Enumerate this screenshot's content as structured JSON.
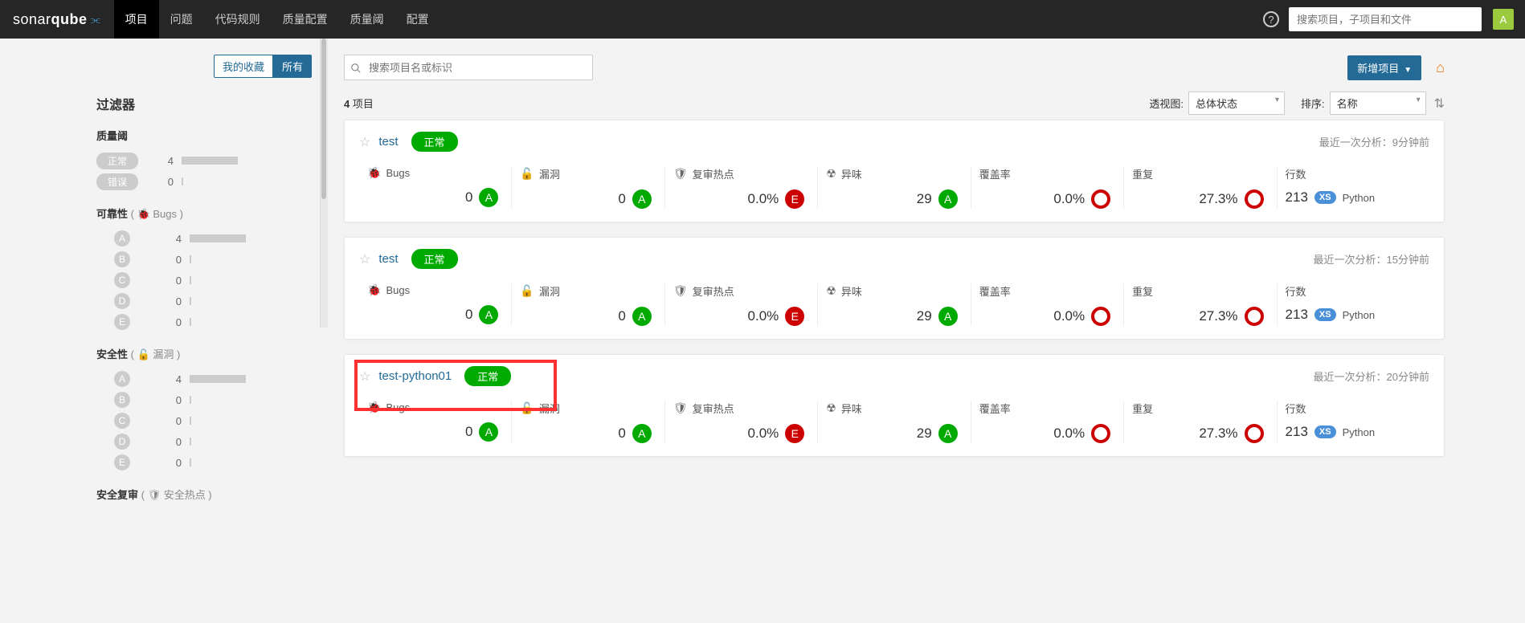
{
  "nav": {
    "brand_a": "sonar",
    "brand_b": "qube",
    "tabs": [
      "项目",
      "问题",
      "代码规则",
      "质量配置",
      "质量阈",
      "配置"
    ],
    "search_placeholder": "搜索项目，子项目和文件",
    "avatar": "A"
  },
  "sidebar": {
    "fav": "我的收藏",
    "all": "所有",
    "filter_title": "过滤器",
    "sections": {
      "quality_gate": {
        "title": "质量阈",
        "items": [
          {
            "label": "正常",
            "count": "4",
            "bar": 70
          },
          {
            "label": "错误",
            "count": "0",
            "bar": 0
          }
        ]
      },
      "reliability": {
        "title": "可靠性",
        "sub": "( 🐞 Bugs )",
        "items": [
          {
            "letter": "A",
            "count": "4",
            "bar": 70
          },
          {
            "letter": "B",
            "count": "0",
            "bar": 0
          },
          {
            "letter": "C",
            "count": "0",
            "bar": 0
          },
          {
            "letter": "D",
            "count": "0",
            "bar": 0
          },
          {
            "letter": "E",
            "count": "0",
            "bar": 0
          }
        ]
      },
      "security": {
        "title": "安全性",
        "sub": "( 🔓 漏洞 )",
        "items": [
          {
            "letter": "A",
            "count": "4",
            "bar": 70
          },
          {
            "letter": "B",
            "count": "0",
            "bar": 0
          },
          {
            "letter": "C",
            "count": "0",
            "bar": 0
          },
          {
            "letter": "D",
            "count": "0",
            "bar": 0
          },
          {
            "letter": "E",
            "count": "0",
            "bar": 0
          }
        ]
      },
      "review": {
        "title": "安全复审",
        "sub": "( 🛡 安全热点 )"
      }
    }
  },
  "content": {
    "search_placeholder": "搜索项目名或标识",
    "new_project": "新增项目",
    "count_num": "4",
    "count_label": "项目",
    "perspective_label": "透视图:",
    "perspective_value": "总体状态",
    "sort_label": "排序:",
    "sort_value": "名称"
  },
  "metric_labels": {
    "bugs": "Bugs",
    "vuln": "漏洞",
    "hotspot": "复审热点",
    "smell": "异味",
    "coverage": "覆盖率",
    "dup": "重复",
    "lines": "行数"
  },
  "projects": [
    {
      "name": "test",
      "status": "正常",
      "last": "最近一次分析：9分钟前",
      "bugs": {
        "v": "0",
        "r": "A"
      },
      "vuln": {
        "v": "0",
        "r": "A"
      },
      "hotspot": {
        "v": "0.0%",
        "r": "E"
      },
      "smell": {
        "v": "29",
        "r": "A"
      },
      "coverage": "0.0%",
      "dup": "27.3%",
      "lines": "213",
      "lang": "Python"
    },
    {
      "name": "test",
      "status": "正常",
      "last": "最近一次分析：15分钟前",
      "bugs": {
        "v": "0",
        "r": "A"
      },
      "vuln": {
        "v": "0",
        "r": "A"
      },
      "hotspot": {
        "v": "0.0%",
        "r": "E"
      },
      "smell": {
        "v": "29",
        "r": "A"
      },
      "coverage": "0.0%",
      "dup": "27.3%",
      "lines": "213",
      "lang": "Python"
    },
    {
      "name": "test-python01",
      "status": "正常",
      "last": "最近一次分析：20分钟前",
      "highlight": true,
      "bugs": {
        "v": "0",
        "r": "A"
      },
      "vuln": {
        "v": "0",
        "r": "A"
      },
      "hotspot": {
        "v": "0.0%",
        "r": "E"
      },
      "smell": {
        "v": "29",
        "r": "A"
      },
      "coverage": "0.0%",
      "dup": "27.3%",
      "lines": "213",
      "lang": "Python"
    }
  ]
}
